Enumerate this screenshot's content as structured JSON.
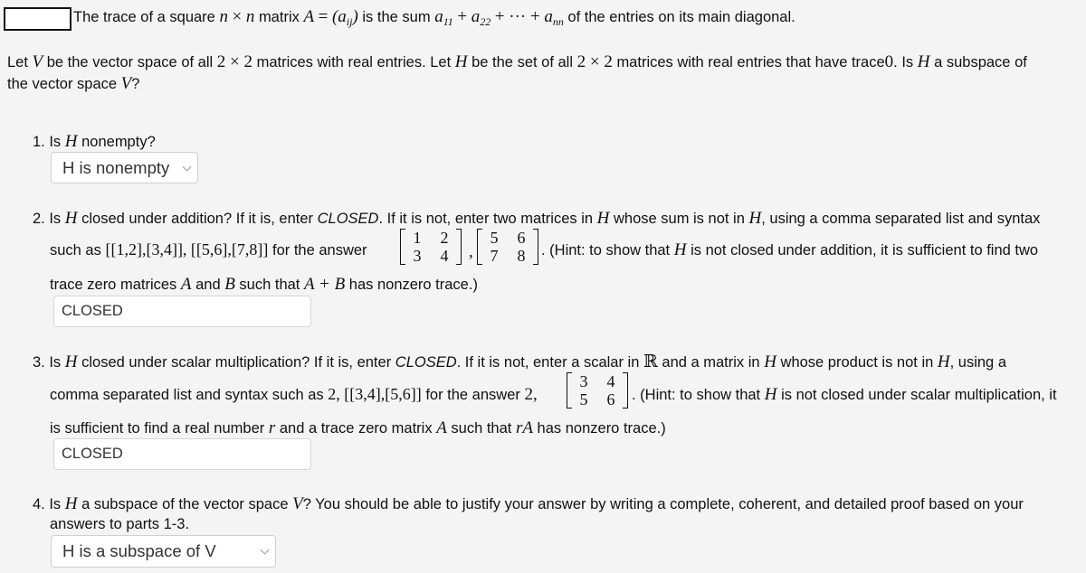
{
  "intro": {
    "answer_box_value": "",
    "t1": "The trace of a square",
    "n1": "n",
    "times": "×",
    "n2": "n",
    "t2": "matrix",
    "A": "A",
    "eq": "=",
    "aij": "(a",
    "aij_sub": "ij",
    "aij_close": ")",
    "t3": "is the sum",
    "a11": "a",
    "a11_sub": "11",
    "plus1": "+",
    "a22": "a",
    "a22_sub": "22",
    "plus2": "+ ··· +",
    "ann": "a",
    "ann_sub": "nn",
    "t4": "of the entries on its main diagonal."
  },
  "problem": {
    "line1_a": "Let",
    "V": "V",
    "line1_b": "be the vector space of all",
    "two_by_two_1": "2 × 2",
    "line1_c": "matrices with real entries. Let",
    "H": "H",
    "line1_d": "be the set of all",
    "two_by_two_2": "2 × 2",
    "line1_e": "matrices with real entries that have trace",
    "zero": "0",
    "line1_f": ". Is",
    "line1_g": "a subspace of",
    "line2_a": "the vector space",
    "line2_b": "?"
  },
  "q1": {
    "prefix": "1. Is",
    "H": "H",
    "suffix": "nonempty?",
    "select_value": "H is nonempty"
  },
  "q2": {
    "l1_a": "2. Is",
    "H": "H",
    "l1_b": "closed under addition? If it is, enter",
    "closed_word": "CLOSED",
    "l1_c": ". If it is not, enter two matrices in",
    "l1_d": "whose sum is not in",
    "l1_e": ", using a comma separated list and syntax",
    "l2_a": "such as",
    "l2_code": "[[1,2],[3,4]],  [[5,6],[7,8]]",
    "l2_b": "for the answer",
    "matrix1": [
      "1",
      "2",
      "3",
      "4"
    ],
    "comma": ",",
    "matrix2": [
      "5",
      "6",
      "7",
      "8"
    ],
    "l2_c": ". (Hint: to show that",
    "l2_d": "is not closed under addition, it is sufficient to find two",
    "l3_a": "trace zero matrices",
    "A": "A",
    "l3_b": "and",
    "B": "B",
    "l3_c": "such that",
    "sum": "A + B",
    "l3_d": "has nonzero trace.)",
    "input_value": "CLOSED"
  },
  "q3": {
    "l1_a": "3. Is",
    "H": "H",
    "l1_b": "closed under scalar multiplication? If it is, enter",
    "closed_word": "CLOSED",
    "l1_c": ". If it is not, enter a scalar in",
    "R": "ℝ",
    "l1_d": "and a matrix in",
    "l1_e": "whose product is not in",
    "l1_f": ", using a",
    "l2_a": "comma separated list and syntax such as",
    "l2_code": "2,  [[3,4],[5,6]]",
    "l2_b": "for the answer",
    "scalar": "2,",
    "matrix": [
      "3",
      "4",
      "5",
      "6"
    ],
    "l2_c": ". (Hint: to show that",
    "l2_d": "is not closed under scalar multiplication, it",
    "l3_a": "is sufficient to find a real number",
    "r": "r",
    "l3_b": "and a trace zero matrix",
    "A": "A",
    "l3_c": "such that",
    "rA": "rA",
    "l3_d": "has nonzero trace.)",
    "input_value": "CLOSED"
  },
  "q4": {
    "l1_a": "4. Is",
    "H": "H",
    "l1_b": "a subspace of the vector space",
    "V": "V",
    "l1_c": "? You should be able to justify your answer by writing a complete, coherent, and detailed proof based on your",
    "l2": "answers to parts 1-3.",
    "select_value": "H is a subspace of V"
  }
}
